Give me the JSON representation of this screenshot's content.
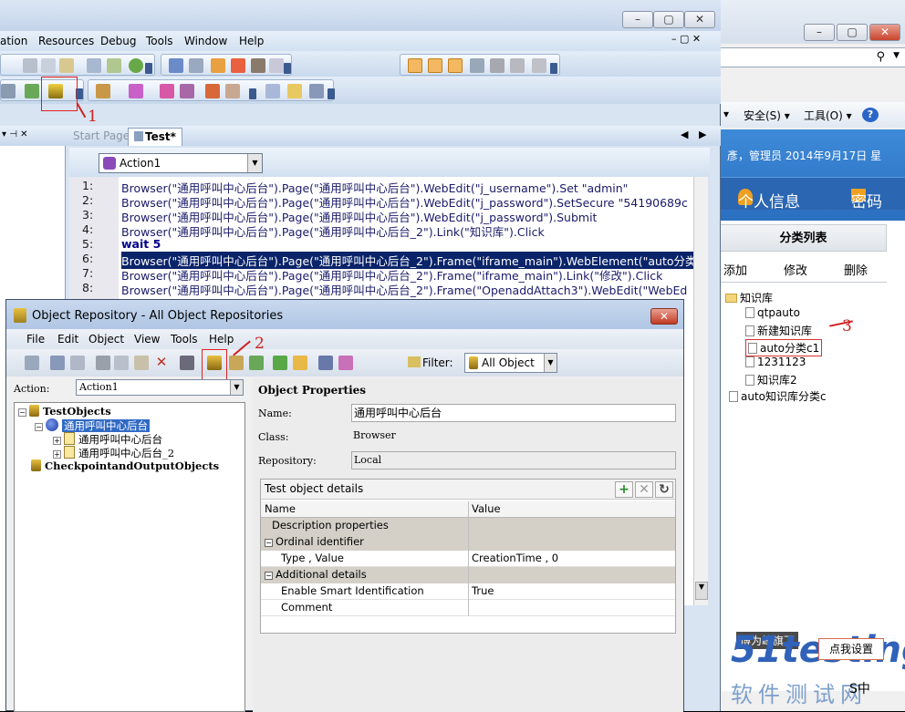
{
  "browser": {
    "address_icon": "search-icon",
    "cmd": {
      "safety": "安全(S) ▾",
      "tools": "工具(O) ▾",
      "help": "?"
    },
    "banner_info": "彥，管理员   2014年9月17日 星",
    "nav_personal": "个人信息",
    "nav_password": "密码",
    "panel_title": "分类列表",
    "panel_buttons": {
      "add": "添加",
      "edit": "修改",
      "delete": "删除"
    },
    "tree": [
      {
        "label": "知识库",
        "kind": "folder"
      },
      {
        "label": "qtpauto",
        "kind": "file"
      },
      {
        "label": "新建知识库",
        "kind": "file"
      },
      {
        "label": "auto分类c1",
        "kind": "file"
      },
      {
        "label": "1231123",
        "kind": "file"
      },
      {
        "label": "知识库2",
        "kind": "file"
      },
      {
        "label": "auto知识库分类c",
        "kind": "file"
      }
    ],
    "setting_button": "点我设置",
    "watermark_badge": "博为峰旗下",
    "watermark_text": "51testing",
    "watermark_sub": "软件测试网",
    "ime": "S中"
  },
  "qtp": {
    "menu": [
      "ation",
      "Resources",
      "Debug",
      "Tools",
      "Window",
      "Help"
    ],
    "annot1": "1",
    "annot2": "2",
    "annot3": "3",
    "tabs": {
      "start": "Start Page",
      "test": "Test*"
    },
    "action_select": "Action1",
    "code_lines": [
      {
        "n": "1:",
        "t": "Browser(\"通用呼叫中心后台\").Page(\"通用呼叫中心后台\").WebEdit(\"j_username\").Set \"admin\""
      },
      {
        "n": "2:",
        "t": "Browser(\"通用呼叫中心后台\").Page(\"通用呼叫中心后台\").WebEdit(\"j_password\").SetSecure \"54190689c"
      },
      {
        "n": "3:",
        "t": "Browser(\"通用呼叫中心后台\").Page(\"通用呼叫中心后台\").WebEdit(\"j_password\").Submit"
      },
      {
        "n": "4:",
        "t": "Browser(\"通用呼叫中心后台\").Page(\"通用呼叫中心后台_2\").Link(\"知识库\").Click"
      },
      {
        "n": "5:",
        "t": "wait 5"
      },
      {
        "n": "6:",
        "t": "Browser(\"通用呼叫中心后台\").Page(\"通用呼叫中心后台_2\").Frame(\"iframe_main\").WebElement(\"auto分类"
      },
      {
        "n": "7:",
        "t": "Browser(\"通用呼叫中心后台\").Page(\"通用呼叫中心后台_2\").Frame(\"iframe_main\").Link(\"修改\").Click"
      },
      {
        "n": "8:",
        "t": "Browser(\"通用呼叫中心后台\").Page(\"通用呼叫中心后台_2\").Frame(\"OpenaddAttach3\").WebEdit(\"WebEd"
      }
    ]
  },
  "orep": {
    "title": "Object Repository - All Object Repositories",
    "menu": [
      "File",
      "Edit",
      "Object",
      "View",
      "Tools",
      "Help"
    ],
    "filter_label": "Filter:",
    "filter_value": "All Object",
    "action_label": "Action:",
    "action_value": "Action1",
    "tree": {
      "test_objects": "TestObjects",
      "browser": "通用呼叫中心后台",
      "page1": "通用呼叫中心后台",
      "page2": "通用呼叫中心后台_2",
      "checkpoints": "CheckpointandOutputObjects"
    },
    "props_header": "Object Properties",
    "name_label": "Name:",
    "name_value": "通用呼叫中心后台",
    "class_label": "Class:",
    "class_value": "Browser",
    "repo_label": "Repository:",
    "repo_value": "Local",
    "details_title": "Test object details",
    "grid_head": {
      "name": "Name",
      "value": "Value"
    },
    "grid_rows": [
      {
        "name": "Description properties",
        "value": "",
        "type": "grp0"
      },
      {
        "name": "Ordinal identifier",
        "value": "",
        "type": "grp"
      },
      {
        "name": "Type , Value",
        "value": "CreationTime , 0",
        "type": "item"
      },
      {
        "name": "Additional details",
        "value": "",
        "type": "grp"
      },
      {
        "name": "Enable Smart Identification",
        "value": "True",
        "type": "item"
      },
      {
        "name": "Comment",
        "value": "",
        "type": "item"
      }
    ]
  }
}
